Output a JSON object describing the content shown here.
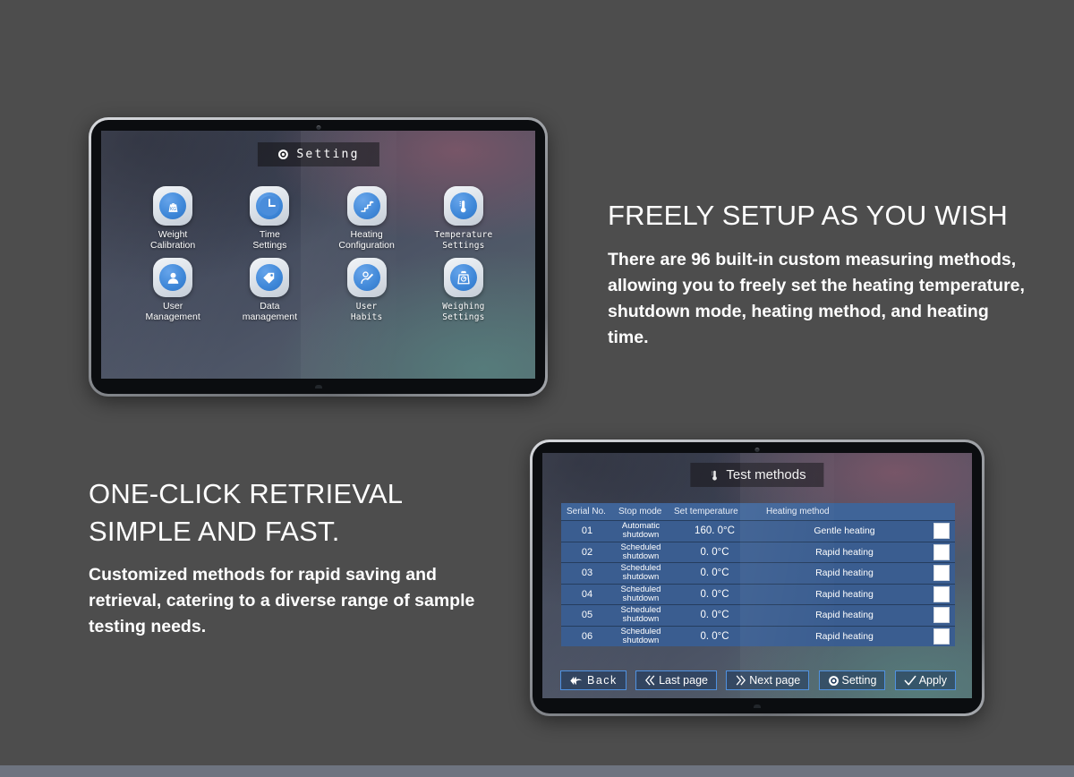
{
  "page": {
    "background_color": "#4d4d4d",
    "bottom_strip_color": "#6e7480"
  },
  "tablet_settings": {
    "title": "Setting",
    "title_icon": "target-icon",
    "items": [
      {
        "label": "Weight\nCalibration",
        "icon": "weight-kg-icon"
      },
      {
        "label": "Time\nSettings",
        "icon": "clock-icon"
      },
      {
        "label": "Heating\nConfiguration",
        "icon": "stairs-heating-icon"
      },
      {
        "label": "Temperature\nSettings",
        "icon": "thermometer-icon"
      },
      {
        "label": "User\nManagement",
        "icon": "user-icon"
      },
      {
        "label": "Data\nmanagement",
        "icon": "tag-data-icon"
      },
      {
        "label": "User\nHabits",
        "icon": "user-edit-icon"
      },
      {
        "label": "Weighing\nSettings",
        "icon": "scale-icon"
      }
    ]
  },
  "tablet_test_methods": {
    "title": "Test methods",
    "title_icon": "thermometer-icon",
    "table": {
      "columns": [
        "Serial No.",
        "Stop mode",
        "Set temperature",
        "Heating method",
        ""
      ],
      "rows": [
        {
          "serial": "01",
          "stop_mode": "Automatic\nshutdown",
          "set_temperature": "160. 0°C",
          "heating_method": "Gentle heating",
          "checked": false
        },
        {
          "serial": "02",
          "stop_mode": "Scheduled\nshutdown",
          "set_temperature": "0. 0°C",
          "heating_method": "Rapid heating",
          "checked": false
        },
        {
          "serial": "03",
          "stop_mode": "Scheduled\nshutdown",
          "set_temperature": "0. 0°C",
          "heating_method": "Rapid heating",
          "checked": false
        },
        {
          "serial": "04",
          "stop_mode": "Scheduled\nshutdown",
          "set_temperature": "0. 0°C",
          "heating_method": "Rapid heating",
          "checked": false
        },
        {
          "serial": "05",
          "stop_mode": "Scheduled\nshutdown",
          "set_temperature": "0. 0°C",
          "heating_method": "Rapid heating",
          "checked": false
        },
        {
          "serial": "06",
          "stop_mode": "Scheduled\nshutdown",
          "set_temperature": "0. 0°C",
          "heating_method": "Rapid heating",
          "checked": false
        }
      ]
    },
    "buttons": [
      {
        "label": "Back",
        "icon": "back-arrow-icon"
      },
      {
        "label": "Last page",
        "icon": "double-chevron-left-icon"
      },
      {
        "label": "Next page",
        "icon": "double-chevron-right-icon"
      },
      {
        "label": "Setting",
        "icon": "target-icon"
      },
      {
        "label": "Apply",
        "icon": "check-icon"
      }
    ],
    "accent_color": "#4f91e0",
    "row_color": "#3a5d90",
    "header_color": "#3f6498"
  },
  "copy_right": {
    "heading": "FREELY SETUP AS YOU WISH",
    "body": "There are 96 built-in custom measuring methods, allowing you to freely set the heating temperature, shutdown mode, heating method, and heating time."
  },
  "copy_left": {
    "heading": "ONE-CLICK RETRIEVAL\nSIMPLE AND FAST.",
    "body": "Customized methods for rapid saving and retrieval, catering to a diverse range of sample testing needs."
  }
}
